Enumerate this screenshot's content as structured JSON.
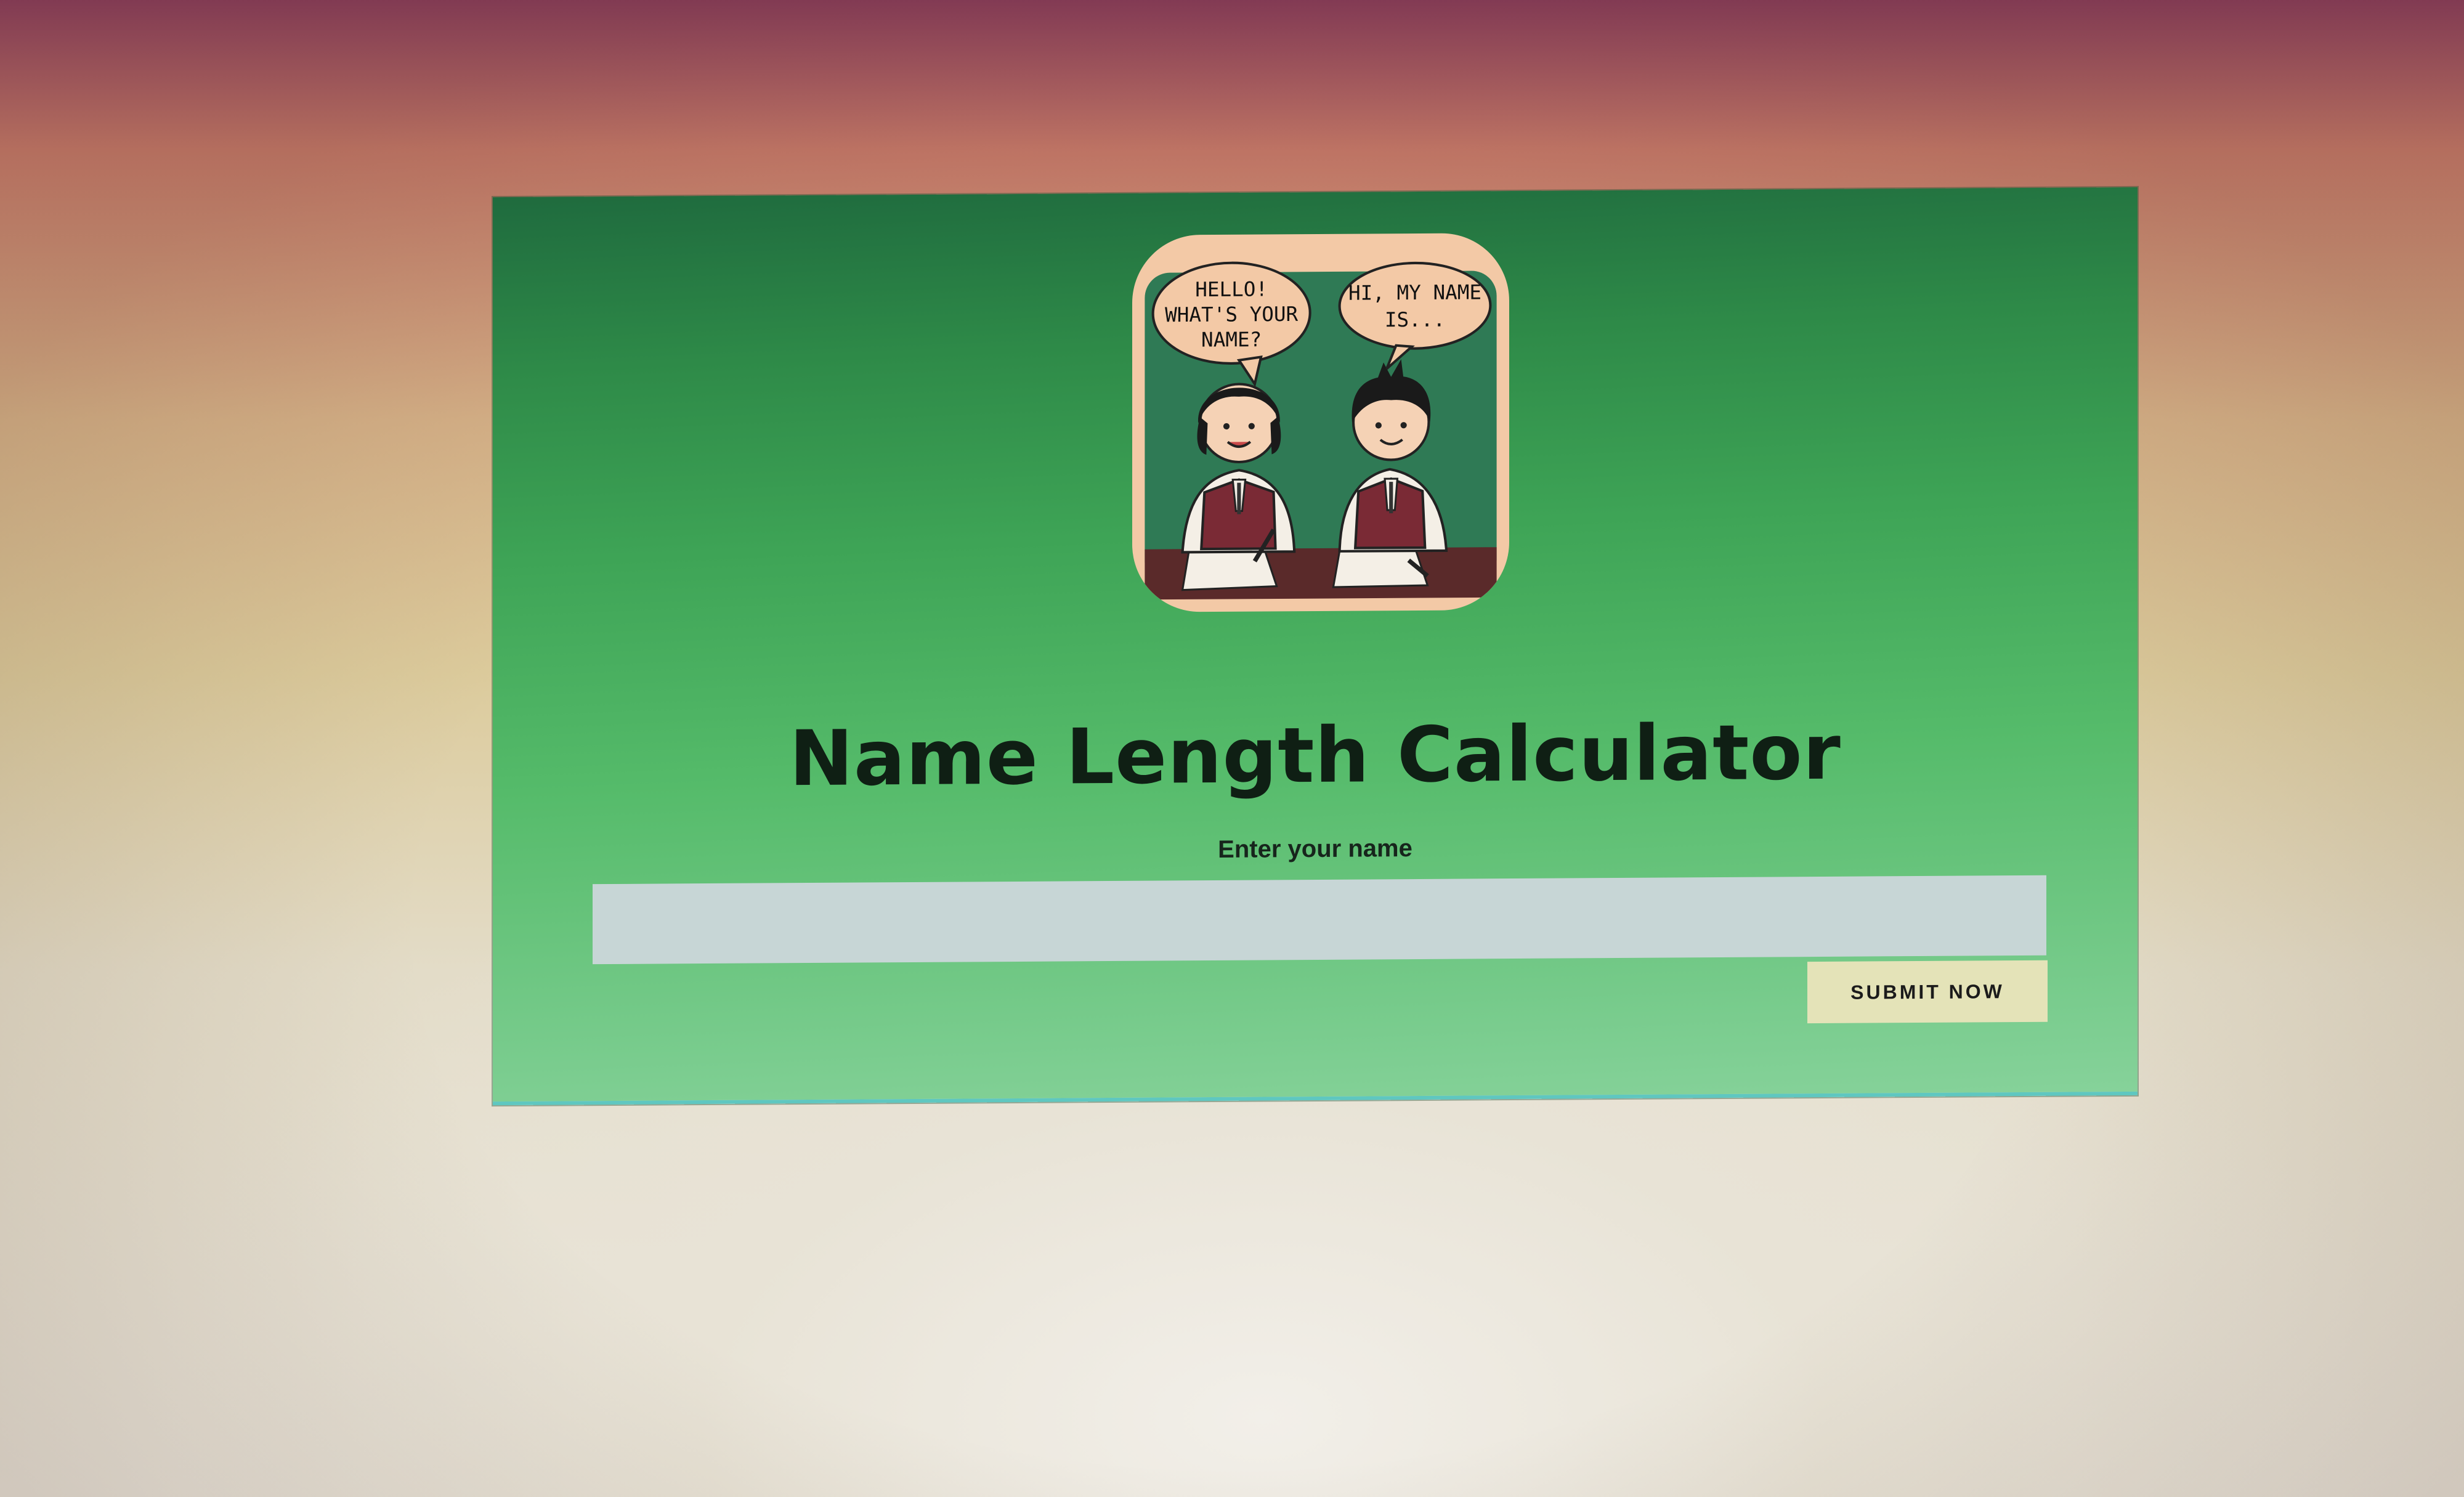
{
  "app": {
    "title": "Name Length Calculator"
  },
  "illustration": {
    "icon": "two-students-talking-illustration",
    "speech_left": [
      "HELLO!",
      "WHAT'S YOUR",
      "NAME?"
    ],
    "speech_right": [
      "HI, MY NAME",
      "IS..."
    ]
  },
  "form": {
    "label": "Enter your name",
    "name_value": "",
    "name_placeholder": "",
    "submit_label": "SUBMIT NOW"
  },
  "colors": {
    "panel_top": "#1f6b3e",
    "panel_bottom": "#86d29a",
    "input_bg": "#c7d6d6",
    "button_bg": "#e4e3b8"
  }
}
